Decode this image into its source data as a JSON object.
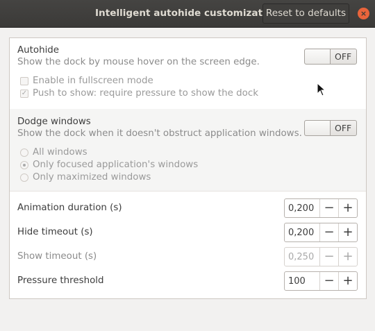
{
  "titlebar": {
    "title": "Intelligent autohide customization",
    "reset_label": "Reset to defaults",
    "close_icon": "×"
  },
  "autohide": {
    "title": "Autohide",
    "subtitle": "Show the dock by mouse hover on the screen edge.",
    "state": "OFF",
    "options": [
      {
        "label": "Enable in fullscreen mode",
        "checked": false
      },
      {
        "label": "Push to show: require pressure to show the dock",
        "checked": true
      }
    ]
  },
  "dodge": {
    "title": "Dodge windows",
    "subtitle": "Show the dock when it doesn't obstruct application windows.",
    "state": "OFF",
    "options": [
      {
        "label": "All windows",
        "selected": false
      },
      {
        "label": "Only focused application's windows",
        "selected": true
      },
      {
        "label": "Only maximized windows",
        "selected": false
      }
    ]
  },
  "settings": [
    {
      "label": "Animation duration (s)",
      "value": "0,200",
      "enabled": true
    },
    {
      "label": "Hide timeout (s)",
      "value": "0,200",
      "enabled": true
    },
    {
      "label": "Show timeout (s)",
      "value": "0,250",
      "enabled": false
    },
    {
      "label": "Pressure threshold",
      "value": "100",
      "enabled": true
    }
  ],
  "spin": {
    "minus": "−",
    "plus": "+"
  },
  "colors": {
    "titlebar": "#3b3a38",
    "close": "#e9643b",
    "panel": "#ffffff"
  }
}
